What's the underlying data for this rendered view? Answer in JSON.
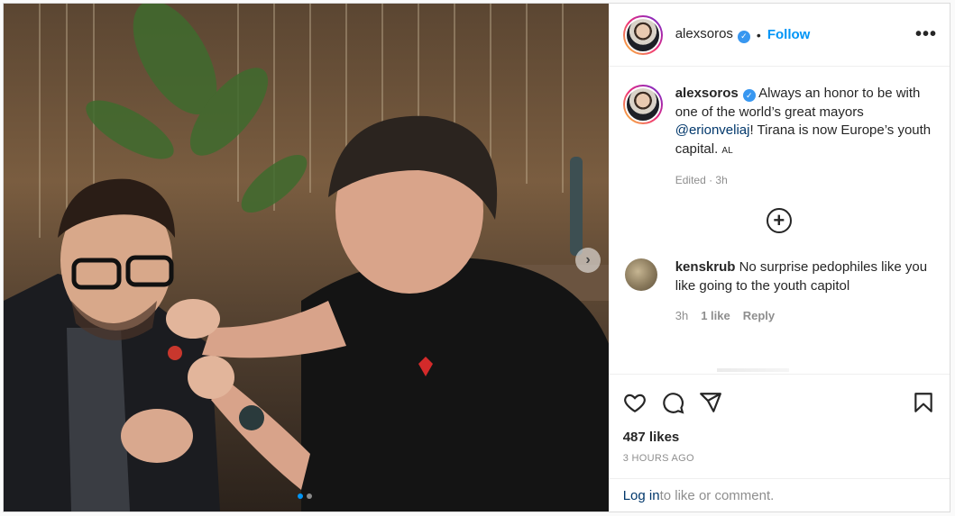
{
  "post": {
    "username": "alexsoros",
    "follow_label": "Follow",
    "separator": "•",
    "more_icon": "more-horizontal-icon",
    "caption": {
      "username": "alexsoros",
      "text_before": " Always an honor to be with one of the world’s great mayors ",
      "mention": "@erionveliaj",
      "text_after": "! Tirana is now Europe’s youth capital. ",
      "flag": "AL",
      "meta": "Edited · 3h"
    },
    "load_more_icon": "plus-circle-icon",
    "comments": [
      {
        "username": "kenskrub",
        "text": " No surprise pedophiles like you like going to the youth capitol",
        "time": "3h",
        "likes": "1 like",
        "reply": "Reply"
      }
    ],
    "likes": "487 likes",
    "timestamp": "3 HOURS AGO",
    "login_link": "Log in",
    "login_text": " to like or comment.",
    "carousel": {
      "current": 1,
      "total": 2
    }
  },
  "colors": {
    "accent": "#0095f6",
    "verified": "#3897f0",
    "text": "#262626",
    "muted": "#8e8e8e"
  }
}
